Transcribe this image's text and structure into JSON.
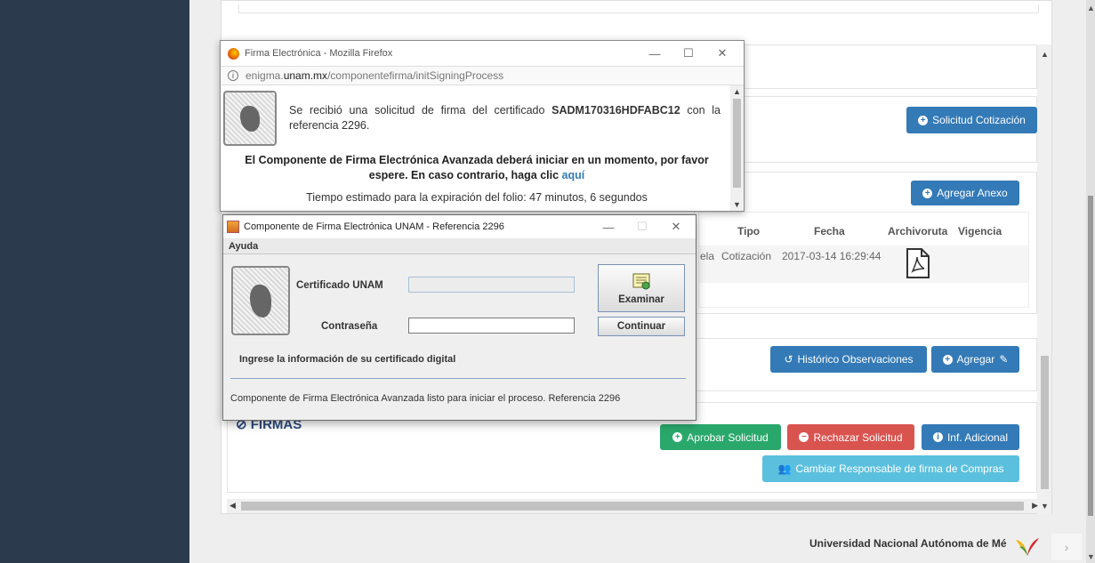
{
  "background_page": {
    "buttons": {
      "solicitud_cotizacion": "Solicitud Cotización",
      "agregar_anexo": "Agregar Anexo",
      "historico_observaciones": "Histórico Observaciones",
      "agregar": "Agregar",
      "aprobar_solicitud": "Aprobar Solicitud",
      "rechazar_solicitud": "Rechazar Solicitud",
      "inf_adicional": "Inf. Adicional",
      "cambiar_responsable": "Cambiar Responsable de firma de Compras"
    },
    "table": {
      "headers": [
        "Tipo",
        "Fecha",
        "Archivoruta",
        "Vigencia"
      ],
      "row": {
        "prefix": "ela",
        "tipo": "Cotización",
        "fecha": "2017-03-14 16:29:44"
      }
    },
    "section_firmas": "FIRMAS",
    "footer": "Universidad Nacional Autónoma de Mé"
  },
  "firefox_popup": {
    "title": "Firma Electrónica - Mozilla Firefox",
    "url_prefix": "enigma.",
    "url_domain": "unam.mx",
    "url_path": "/componentefirma/initSigningProcess",
    "message_part1": "Se recibió una solicitud de firma del certificado",
    "certificate": "SADM170316HDFABC12",
    "message_part2": "con la referencia 2296.",
    "bold_message": "El Componente de Firma Electrónica Avanzada deberá iniciar en un momento, por favor espere. En caso contrario, haga clic",
    "link_text": "aquí",
    "expiration": "Tiempo estimado para la expiración del folio: 47 minutos, 6 segundos"
  },
  "java_dialog": {
    "title": "Componente de Firma Electrónica UNAM - Referencia 2296",
    "menu": "Ayuda",
    "certificado_label": "Certificado UNAM",
    "contrasena_label": "Contraseña",
    "examinar": "Examinar",
    "continuar": "Continuar",
    "instruction": "Ingrese la información de su certificado digital",
    "status": "Componente de Firma Electrónica Avanzada listo para iniciar el proceso. Referencia 2296"
  },
  "colors": {
    "sidebar": "#2b3a4d",
    "primary": "#337ab7",
    "success": "#2aa86c",
    "danger": "#d9534f",
    "info": "#5bc0de"
  }
}
